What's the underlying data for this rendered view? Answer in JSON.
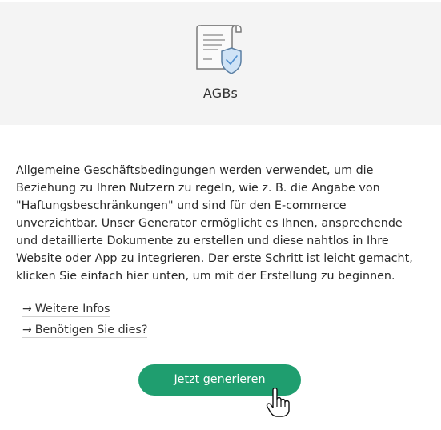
{
  "card": {
    "icon": "document-shield-icon",
    "title": "AGBs",
    "description": "Allgemeine Geschäftsbedingungen werden verwendet, um die Beziehung zu Ihren Nutzern zu regeln, wie z. B. die Angabe von \"Haftungsbeschränkungen\" und sind für den E-commerce unverzichtbar. Unser Generator ermöglicht es Ihnen, ansprechende und detaillierte Dokumente zu erstellen und diese nahtlos in Ihre Website oder App zu integrieren. Der erste Schritt ist leicht gemacht, klicken Sie einfach hier unten, um mit der Erstellung zu beginnen.",
    "links": [
      {
        "label": "Weitere Infos",
        "icon": "arrow-right-icon"
      },
      {
        "label": "Benötigen Sie dies?",
        "icon": "arrow-right-icon"
      }
    ],
    "button_label": "Jetzt generieren"
  },
  "colors": {
    "header_bg": "#f4f4f4",
    "button_bg": "#1f9e6f",
    "icon_accent": "#5b9fd8"
  }
}
